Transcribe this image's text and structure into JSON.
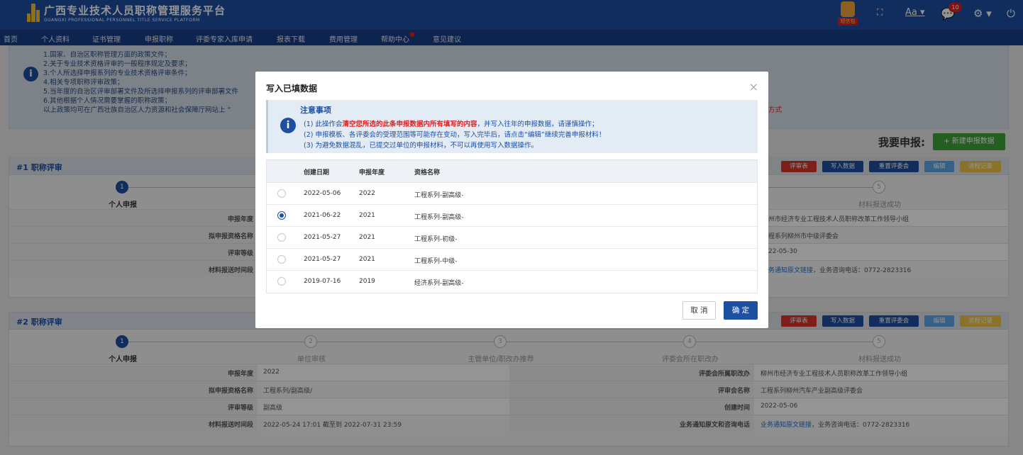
{
  "brand": {
    "title": "广西专业技术人员职称管理服务平台",
    "subtitle": "GUANGXI PROFESSIONAL PERSONNEL TITLE SERVICE PLATFORM"
  },
  "header_icons": {
    "app_badge": "短信包",
    "font_label": "Aa",
    "notify_count": "10"
  },
  "nav": [
    "首页",
    "个人资料",
    "证书管理",
    "申报职称",
    "评委专家入库申请",
    "报表下载",
    "费用管理",
    "帮助中心",
    "意见建议"
  ],
  "notice": [
    "1.国家、自治区职称管理方面的政策文件；",
    "2.关于专业技术资格评审的一般程序规定及要求；",
    "3.个人所选择申报系列的专业技术资格评审条件；",
    "4.相关专项职称评审政策；",
    "5.当年度的自治区评审部署文件及所选择申报系列的评审部署文件",
    "6.其他根据个人情况需要掌握的职称政策；",
    "以上政策均可在广西壮族自治区人力资源和社会保障厅网站上 “"
  ],
  "notice_tail": "方式",
  "apply": {
    "label": "我要申报:",
    "button": "+ 新建申报数据"
  },
  "panel_buttons": [
    "评审表",
    "写入数据",
    "重置评委会",
    "编辑",
    "流程记录"
  ],
  "steps": [
    "个人申报",
    "单位审核",
    "主管单位/职改办推荐",
    "评委会所在职改办",
    "材料报送成功"
  ],
  "panels": [
    {
      "title": "#1 职称评审",
      "rows": [
        {
          "l": "申报年度",
          "v": "",
          "l2": "",
          "v2": "州市经济专业工程技术人员职称改革工作领导小组"
        },
        {
          "l": "拟申报资格名称",
          "v": "",
          "l2": "",
          "v2": "程系列柳州市中级评委会"
        },
        {
          "l": "评审等级",
          "v": "",
          "l2": "",
          "v2": "22-05-30"
        },
        {
          "l": "材料报送时间段",
          "v": "",
          "l2": "",
          "v2_link": "务通知原文链接",
          "v2": "，业务咨询电话：0772-2823316"
        }
      ]
    },
    {
      "title": "#2 职称评审",
      "rows": [
        {
          "l": "申报年度",
          "v": "2022",
          "l2": "评委会所属职改办",
          "v2": "柳州市经济专业工程技术人员职称改革工作领导小组"
        },
        {
          "l": "拟申报资格名称",
          "v": "工程系列/副高级/",
          "l2": "评审会名称",
          "v2": "工程系列柳州汽车产业副高级评委会"
        },
        {
          "l": "评审等级",
          "v": "副高级",
          "l2": "创建时间",
          "v2": "2022-05-06"
        },
        {
          "l": "材料报送时间段",
          "v": "2022-05-24 17:01 截至到 2022-07-31 23:59",
          "l2": "业务通知原文和咨询电话",
          "v2_link": "业务通知原文链接",
          "v2": "，业务咨询电话：0772-2823316"
        }
      ]
    }
  ],
  "modal": {
    "title": "写入已填数据",
    "close": "×",
    "alert_title": "注意事项",
    "alert_1a": "(1) 此操作会",
    "alert_1b": "清空您所选的此条申报数据内所有填写的内容",
    "alert_1c": "，并写入往年的申报数据，请谨慎操作；",
    "alert_2": "(2) 申报模板、各评委会的受理范围等可能存在变动，写入完毕后，请点击“编辑”继续完善申报材料！",
    "alert_3": "(3) 为避免数据混乱，已提交过单位的申报材料，不可以再使用写入数据操作。",
    "columns": [
      "创建日期",
      "申报年度",
      "资格名称"
    ],
    "rows": [
      {
        "date": "2022-05-06",
        "year": "2022",
        "name": "工程系列-副高级-",
        "selected": false
      },
      {
        "date": "2021-06-22",
        "year": "2021",
        "name": "工程系列-副高级-",
        "selected": true
      },
      {
        "date": "2021-05-27",
        "year": "2021",
        "name": "工程系列-初级-",
        "selected": false
      },
      {
        "date": "2021-05-27",
        "year": "2021",
        "name": "工程系列-中级-",
        "selected": false
      },
      {
        "date": "2019-07-16",
        "year": "2019",
        "name": "经济系列-副高级-",
        "selected": false
      }
    ],
    "cancel": "取 消",
    "ok": "确 定"
  }
}
